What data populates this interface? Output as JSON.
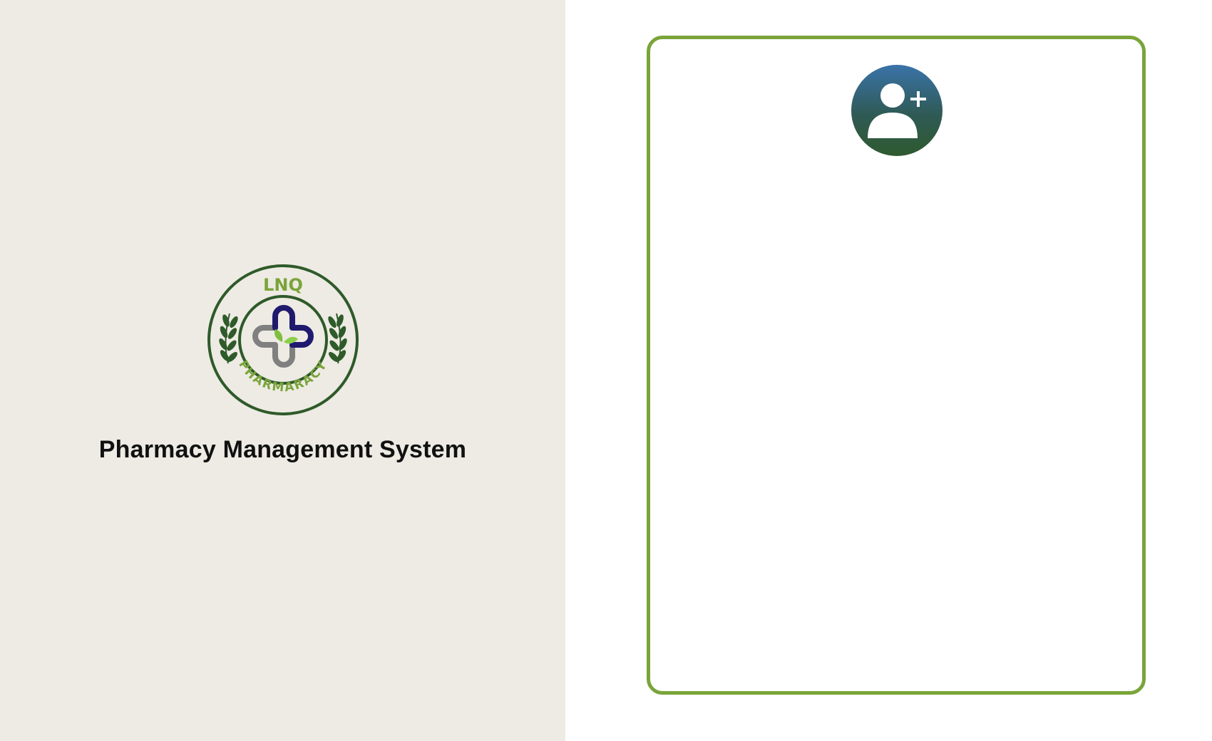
{
  "branding": {
    "logo_text_top": "LNQ",
    "logo_text_bottom": "PHARMARACY",
    "app_title": "Pharmacy Management System"
  },
  "signup_card": {
    "icon": "user-plus-icon"
  },
  "colors": {
    "left_panel_bg": "#edebe3",
    "card_border": "#7aa43a",
    "logo_dark_green": "#2f5a2a",
    "logo_light_green": "#7aa43a",
    "logo_navy": "#1f1a6e",
    "logo_gray": "#808080",
    "avatar_top": "#3a73a8",
    "avatar_bottom": "#2f5a2f"
  }
}
